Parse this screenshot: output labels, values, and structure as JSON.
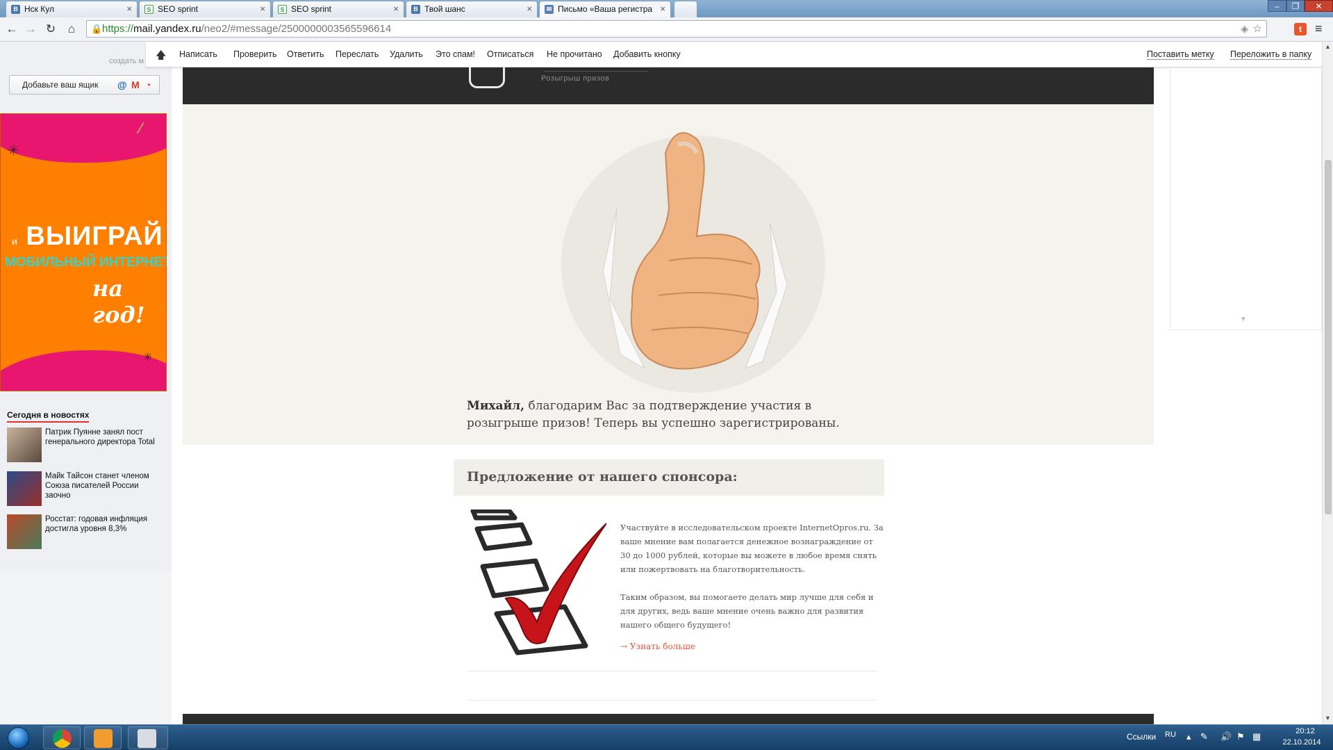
{
  "browser": {
    "tabs": [
      {
        "title": "Нск Кул",
        "favicon": "В"
      },
      {
        "title": "SEO sprint",
        "favicon": "S"
      },
      {
        "title": "SEO sprint",
        "favicon": "S"
      },
      {
        "title": "Твой шанс",
        "favicon": "В"
      },
      {
        "title": "Письмо «Ваша регистра",
        "favicon": "✉"
      }
    ],
    "url_protocol": "https://",
    "url_host": "mail.yandex.ru",
    "url_path": "/neo2/#message/2500000003565596614"
  },
  "sidebar": {
    "create_hint": "создать м",
    "add_box_label": "Добавьте ваш ящик",
    "banner": {
      "line1_small": "и",
      "line1_big": "ВЫИГРАЙ",
      "line2": "МОБИЛЬНЫЙ ИНТЕРНЕТ",
      "line3": "на год!"
    },
    "news_title": "Сегодня в новостях",
    "news": [
      {
        "text": "Патрик Пуянне занял пост генерального директора Total"
      },
      {
        "text": "Майк Тайсон станет членом Союза писателей России заочно"
      },
      {
        "text": "Росстат: годовая инфляция достигла уровня 8,3%"
      }
    ]
  },
  "actions": {
    "items": [
      "Написать",
      "Проверить",
      "Ответить",
      "Переслать",
      "Удалить",
      "Это спам!",
      "Отписаться",
      "Не прочитано",
      "Добавить кнопку"
    ],
    "right_items": [
      "Поставить метку",
      "Переложить в папку"
    ]
  },
  "email": {
    "header_tag": "Розыгрыш призов",
    "greeting_name": "Михайл,",
    "greeting_text": " благодарим Вас за подтверждение участия в розыгрыше призов! Теперь вы успешно зарегистрированы.",
    "sponsor_title": "Предложение от нашего спонсора:",
    "offer_p1": "Участвуйте в исследовательском проекте InternetOpros.ru. За ваше мнение вам полагается денежное вознаграждение от 30 до 1000 рублей, которые вы можете в любое время снять или пожертвовать на благотворительность.",
    "offer_p2": "Таким образом, вы помогаете делать мир лучше для себя и для других, ведь ваше мнение очень важно для развития нашего общего будущего!",
    "learn_more": "→ Узнать больше"
  },
  "taskbar": {
    "links_label": "Ссылки",
    "lang": "RU",
    "time": "20:12",
    "date": "22.10.2014"
  },
  "colors": {
    "accent_orange": "#ff7f00",
    "accent_pink": "#e8166e",
    "link_red": "#e0543a",
    "header_dark": "#2b2b2b",
    "hero_bg": "#f5f3ee"
  }
}
